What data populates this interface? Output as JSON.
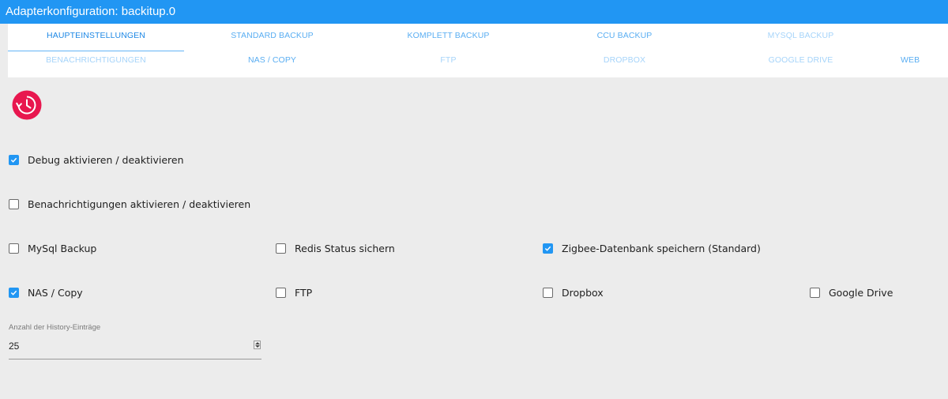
{
  "window": {
    "title": "Adapterkonfiguration: backitup.0"
  },
  "tabs": {
    "row1": [
      {
        "label": "HAUPTEINSTELLUNGEN",
        "active": true
      },
      {
        "label": "STANDARD BACKUP"
      },
      {
        "label": "KOMPLETT BACKUP"
      },
      {
        "label": "CCU BACKUP"
      },
      {
        "label": "MYSQL BACKUP"
      }
    ],
    "row2": [
      {
        "label": "BENACHRICHTIGUNGEN"
      },
      {
        "label": "NAS / COPY"
      },
      {
        "label": "FTP"
      },
      {
        "label": "DROPBOX"
      },
      {
        "label": "GOOGLE DRIVE"
      },
      {
        "label": "WEB"
      }
    ]
  },
  "logo": {
    "icon": "backup-history-icon",
    "color": "#e8174f"
  },
  "options": {
    "debug": {
      "label": "Debug aktivieren / deaktivieren",
      "checked": true
    },
    "notifications": {
      "label": "Benachrichtigungen aktivieren / deaktivieren",
      "checked": false
    },
    "mysql": {
      "label": "MySql Backup",
      "checked": false
    },
    "redis": {
      "label": "Redis Status sichern",
      "checked": false
    },
    "zigbee": {
      "label": "Zigbee-Datenbank speichern (Standard)",
      "checked": true
    },
    "nas": {
      "label": "NAS / Copy",
      "checked": true
    },
    "ftp": {
      "label": "FTP",
      "checked": false
    },
    "dropbox": {
      "label": "Dropbox",
      "checked": false
    },
    "googledrive": {
      "label": "Google Drive",
      "checked": false
    }
  },
  "history": {
    "label": "Anzahl der History-Einträge",
    "value": "25"
  },
  "colors": {
    "accent": "#2196f3",
    "background": "#ececec"
  }
}
